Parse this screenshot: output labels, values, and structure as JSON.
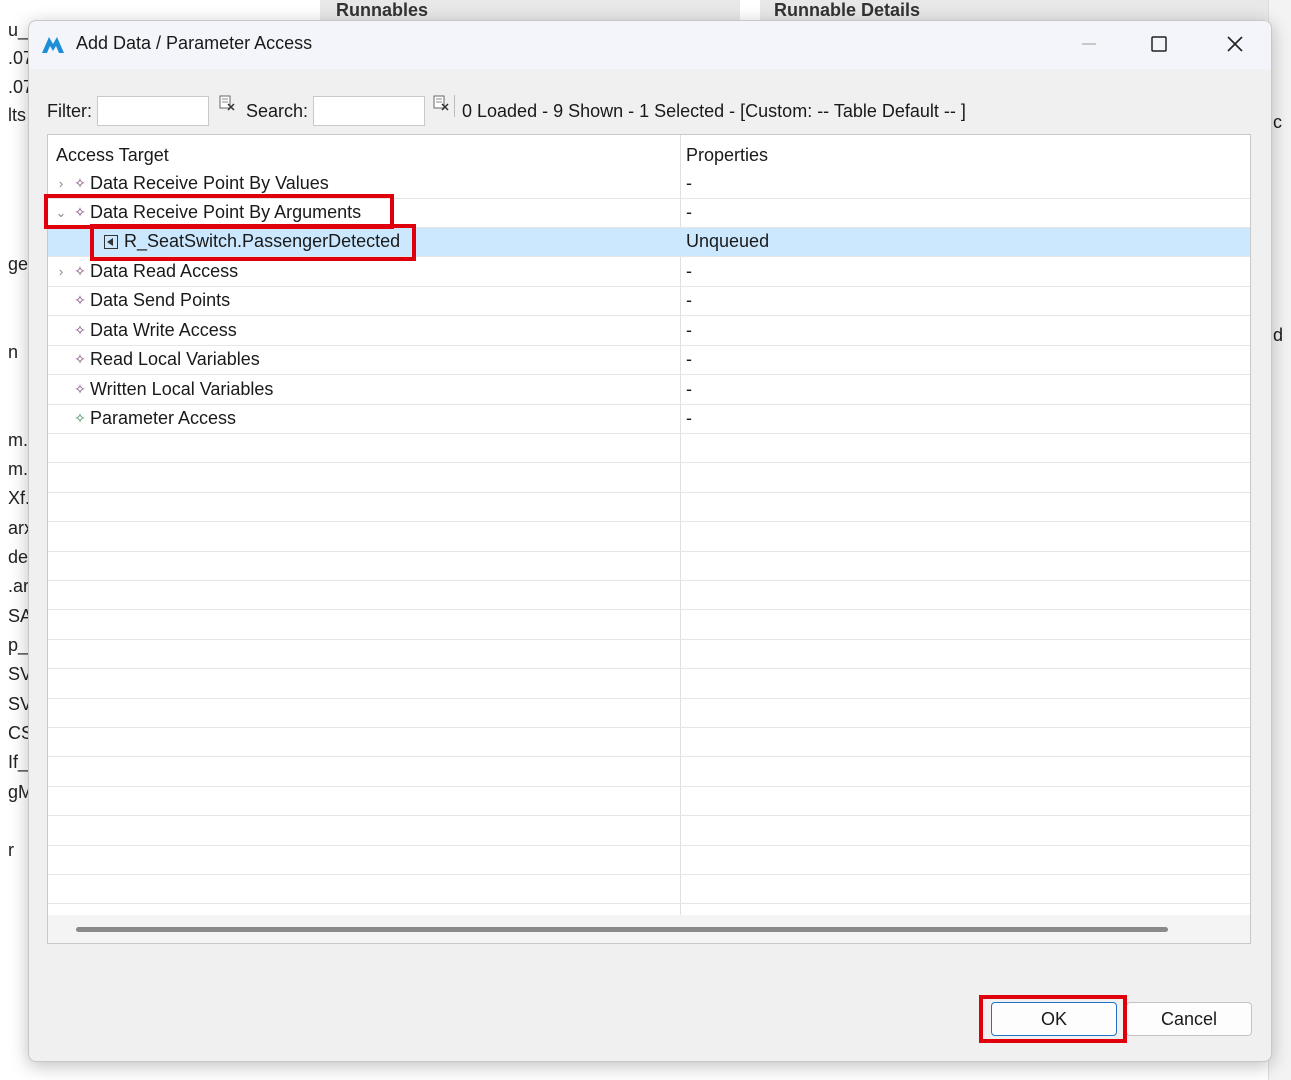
{
  "background": {
    "left_fragments": [
      "u_",
      ".07",
      ".07",
      "lts",
      "ge",
      "n",
      "m.a",
      "m.a",
      "Xf.",
      "arx",
      "de",
      ".ar",
      "SA",
      "p_",
      "SV",
      "SV",
      "CS",
      "If_",
      "gM",
      "r"
    ],
    "runnables_header": "Runnables",
    "runnable_details_header": "Runnable Details",
    "right_fragments": [
      "c",
      "d"
    ]
  },
  "dialog": {
    "title": "Add Data / Parameter Access",
    "filter_label": "Filter:",
    "filter_value": "",
    "search_label": "Search:",
    "search_value": "",
    "status": "0 Loaded - 9 Shown - 1 Selected -  [Custom: -- Table Default -- ]",
    "columns": [
      "Access Target",
      "Properties"
    ],
    "rows": [
      {
        "label": "Data Receive Point By Values",
        "prop": "-"
      },
      {
        "label": "Data Receive Point By Arguments",
        "prop": "-"
      },
      {
        "label": "R_SeatSwitch.PassengerDetected",
        "prop": "Unqueued"
      },
      {
        "label": "Data Read Access",
        "prop": "-"
      },
      {
        "label": "Data Send Points",
        "prop": "-"
      },
      {
        "label": "Data Write Access",
        "prop": "-"
      },
      {
        "label": "Read Local Variables",
        "prop": "-"
      },
      {
        "label": "Written Local Variables",
        "prop": "-"
      },
      {
        "label": "Parameter Access",
        "prop": "-"
      }
    ],
    "ok_label": "OK",
    "cancel_label": "Cancel"
  },
  "colors": {
    "selection": "#cce8ff",
    "annotation_red": "#e0000b",
    "ok_border": "#1f74c8"
  }
}
